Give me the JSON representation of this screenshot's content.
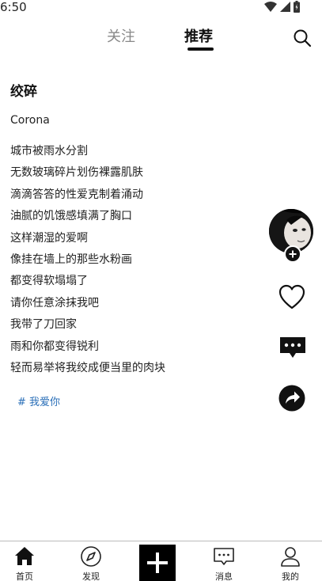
{
  "status_bar": {
    "time": "6:50",
    "icons": [
      "wifi-icon",
      "signal-icon",
      "battery-icon"
    ]
  },
  "header": {
    "tabs": [
      {
        "label": "关注",
        "active": false
      },
      {
        "label": "推荐",
        "active": true
      }
    ],
    "search_icon": "search-icon"
  },
  "post": {
    "title": "绞碎",
    "author": "Corona",
    "lines": [
      "城市被雨水分割",
      "无数玻璃碎片划伤裸露肌肤",
      "滴滴答答的性爱克制着涌动",
      "油腻的饥饿感填满了胸口",
      "这样潮湿的爱啊",
      "像挂在墙上的那些水粉画",
      "都变得软塌塌了",
      "请你任意涂抹我吧",
      "我带了刀回家",
      "雨和你都变得锐利",
      "轻而易举将我绞成便当里的肉块"
    ],
    "hashtag": "# 我爱你"
  },
  "side_actions": {
    "icons": [
      "avatar",
      "follow-plus-icon",
      "heart-icon",
      "comment-icon",
      "share-icon"
    ]
  },
  "bottom_nav": {
    "items": [
      {
        "label": "首页",
        "icon": "home-icon"
      },
      {
        "label": "发现",
        "icon": "compass-icon"
      },
      {
        "label": "消息",
        "icon": "message-icon"
      },
      {
        "label": "我的",
        "icon": "user-icon"
      }
    ],
    "publish_icon": "plus-icon"
  },
  "colors": {
    "accent_link": "#2a6fb8",
    "text_primary": "#111111",
    "tab_inactive": "#888888"
  }
}
